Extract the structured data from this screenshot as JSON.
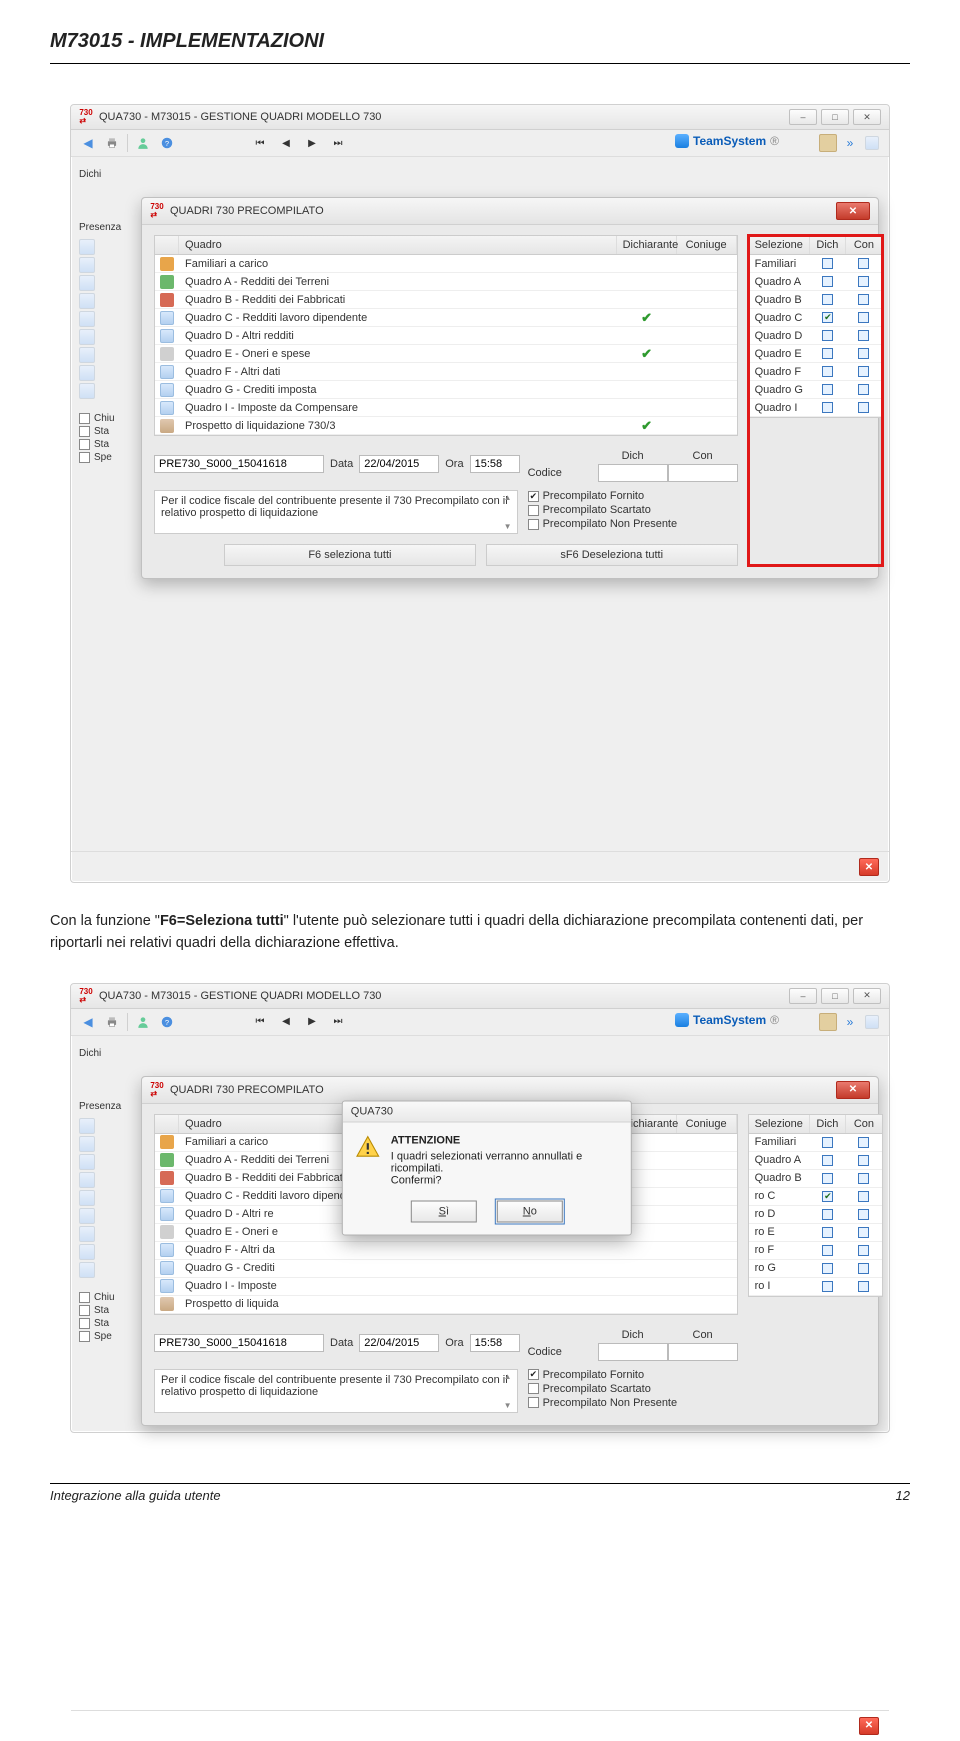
{
  "page_header": "M73015 - IMPLEMENTAZIONI",
  "para1_pre": "Con la funzione \"",
  "para1_bold": "F6=Seleziona tutti",
  "para1_post": "\" l'utente può selezionare tutti i quadri della dichiarazione precompilata contenenti dati, per riportarli nei relativi quadri della dichiarazione effettiva.",
  "footer_left": "Integrazione alla guida utente",
  "footer_right": "12",
  "outer_window_title": "QUA730 - M73015 - GESTIONE QUADRI MODELLO 730",
  "brand_name": "TeamSystem",
  "brand_suffix": "®",
  "left_labels": {
    "dichi": "Dichi",
    "presenza": "Presenza"
  },
  "left_checks": [
    "Chiu",
    "Sta",
    "Sta",
    "Spe"
  ],
  "inner_title": "QUADRI 730 PRECOMPILATO",
  "grid_headers": {
    "quadro": "Quadro",
    "dich": "Dichiarante",
    "con": "Coniuge"
  },
  "grid_rows": [
    {
      "icon": "ic-fam",
      "name": "Familiari a carico",
      "dich": false,
      "con": false
    },
    {
      "icon": "ic-terr",
      "name": "Quadro A - Redditi dei Terreni",
      "dich": false,
      "con": false
    },
    {
      "icon": "ic-fab",
      "name": "Quadro B - Redditi dei Fabbricati",
      "dich": false,
      "con": false
    },
    {
      "icon": "ic-doc",
      "name": "Quadro C - Redditi lavoro dipendente",
      "dich": true,
      "con": false
    },
    {
      "icon": "ic-doc",
      "name": "Quadro D - Altri redditi",
      "dich": false,
      "con": false
    },
    {
      "icon": "ic-gear",
      "name": "Quadro E - Oneri e spese",
      "dich": true,
      "con": false
    },
    {
      "icon": "ic-doc",
      "name": "Quadro F - Altri dati",
      "dich": false,
      "con": false
    },
    {
      "icon": "ic-doc",
      "name": "Quadro G - Crediti imposta",
      "dich": false,
      "con": false
    },
    {
      "icon": "ic-doc",
      "name": "Quadro I - Imposte da Compensare",
      "dich": false,
      "con": false
    },
    {
      "icon": "ic-liq",
      "name": "Prospetto di liquidazione 730/3",
      "dich": true,
      "con": false
    }
  ],
  "grid_rows2": [
    {
      "icon": "ic-fam",
      "name": "Familiari a carico"
    },
    {
      "icon": "ic-terr",
      "name": "Quadro A - Redditi dei Terreni"
    },
    {
      "icon": "ic-fab",
      "name": "Quadro B - Redditi dei Fabbricati"
    },
    {
      "icon": "ic-doc",
      "name": "Quadro C - Redditi lavoro dipendente"
    },
    {
      "icon": "ic-doc",
      "name": "Quadro D - Altri re"
    },
    {
      "icon": "ic-gear",
      "name": "Quadro E - Oneri e"
    },
    {
      "icon": "ic-doc",
      "name": "Quadro F - Altri da"
    },
    {
      "icon": "ic-doc",
      "name": "Quadro G - Crediti"
    },
    {
      "icon": "ic-doc",
      "name": "Quadro I - Imposte"
    },
    {
      "icon": "ic-liq",
      "name": "Prospetto di liquida"
    }
  ],
  "sel_headers": {
    "sel": "Selezione",
    "dich": "Dich",
    "con": "Con"
  },
  "sel_rows": [
    {
      "name": "Familiari",
      "dich": false,
      "con": false
    },
    {
      "name": "Quadro A",
      "dich": false,
      "con": false
    },
    {
      "name": "Quadro B",
      "dich": false,
      "con": false
    },
    {
      "name": "Quadro C",
      "dich": true,
      "con": false
    },
    {
      "name": "Quadro D",
      "dich": false,
      "con": false
    },
    {
      "name": "Quadro E",
      "dich": false,
      "con": false
    },
    {
      "name": "Quadro F",
      "dich": false,
      "con": false
    },
    {
      "name": "Quadro G",
      "dich": false,
      "con": false
    },
    {
      "name": "Quadro I",
      "dich": false,
      "con": false
    }
  ],
  "sel_rows2": [
    {
      "name": "Familiari"
    },
    {
      "name": "Quadro A"
    },
    {
      "name": "Quadro B"
    },
    {
      "name": "ro C",
      "dcheck": true
    },
    {
      "name": "ro D"
    },
    {
      "name": "ro E"
    },
    {
      "name": "ro F"
    },
    {
      "name": "ro G"
    },
    {
      "name": "ro I"
    }
  ],
  "file_field": "PRE730_S000_15041618",
  "data_lbl": "Data",
  "data_val": "22/04/2015",
  "ora_lbl": "Ora",
  "ora_val": "15:58",
  "cod_lbl": "Codice",
  "info_text": "Per il codice fiscale del contribuente presente il 730 Precompilato con il relativo prospetto di liquidazione",
  "dich_hdr": "Dich",
  "con_hdr": "Con",
  "precomp_checks": [
    {
      "label": "Precompilato Fornito",
      "checked": true
    },
    {
      "label": "Precompilato Scartato",
      "checked": false
    },
    {
      "label": "Precompilato Non Presente",
      "checked": false
    }
  ],
  "btn_select_all": "F6 seleziona tutti",
  "btn_deselect_all": "sF6 Deseleziona tutti",
  "confirm": {
    "title": "QUA730",
    "heading": "ATTENZIONE",
    "body1": "I quadri selezionati verranno annullati e ricompilati.",
    "body2": "Confermi?",
    "yes": "Sì",
    "no": "No"
  }
}
